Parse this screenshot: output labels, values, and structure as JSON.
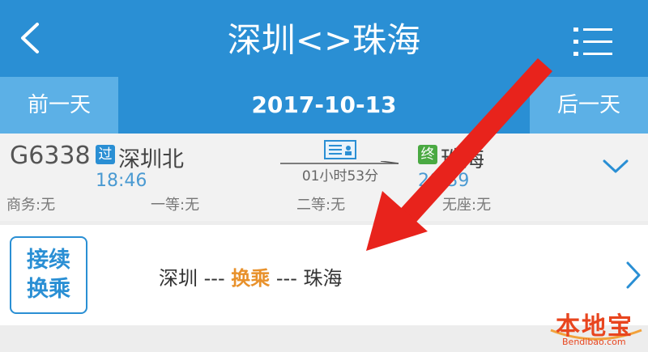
{
  "header": {
    "title": "深圳<>珠海",
    "back_icon": "chevron-left-icon",
    "menu_icon": "list-menu-icon"
  },
  "datebar": {
    "prev": "前一天",
    "date": "2017-10-13",
    "next": "后一天"
  },
  "train": {
    "number": "G6338",
    "pass_badge": "过",
    "departure_station": "深圳北",
    "departure_time": "18:46",
    "duration": "01小时53分",
    "end_badge": "终",
    "arrival_station": "珠海",
    "arrival_time": "20:39",
    "seats": [
      {
        "label": "商务:无"
      },
      {
        "label": "一等:无"
      },
      {
        "label": "二等:无"
      },
      {
        "label": "无座:无"
      }
    ]
  },
  "transfer": {
    "badge_line1": "接续",
    "badge_line2": "换乘",
    "from": "深圳 --- ",
    "middle": "换乘",
    "to": " --- 珠海"
  },
  "watermark": {
    "text": "本地宝",
    "url": "Bendibao.com"
  },
  "colors": {
    "header_blue": "#2a8fd4",
    "date_button_blue": "#5cb0e6",
    "highlight_orange": "#e8912b",
    "arrow_red": "#e8231c",
    "end_badge_green": "#4aa942"
  }
}
